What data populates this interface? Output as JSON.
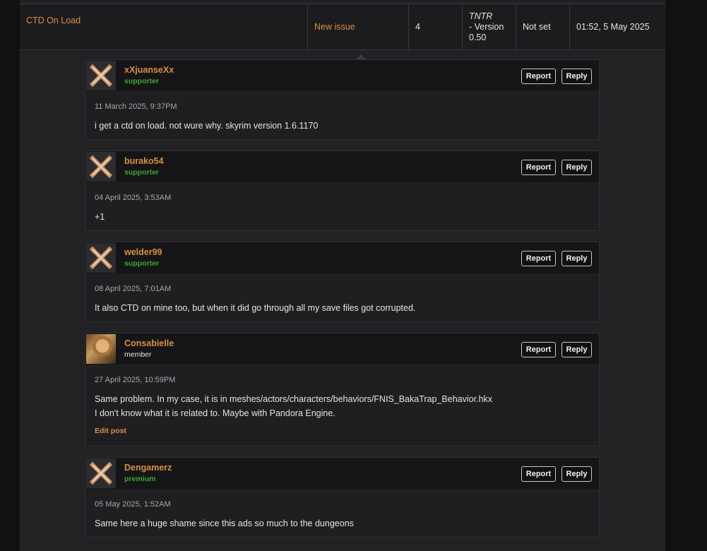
{
  "issue": {
    "title": "CTD On Load",
    "status": "New issue",
    "replies": "4",
    "version_mod": "TNTR",
    "version_label": "- Version 0.50",
    "priority": "Not set",
    "last_updated": "01:52, 5 May 2025"
  },
  "comments": [
    {
      "author": "xXjuanseXx",
      "role": "supporter",
      "date": "11 March 2025, 9:37PM",
      "text": "i get a ctd on load. not wure why. skyrim version 1.6.1170"
    },
    {
      "author": "burako54",
      "role": "supporter",
      "date": "04 April 2025, 3:53AM",
      "text": "+1"
    },
    {
      "author": "welder99",
      "role": "supporter",
      "date": "08 April 2025, 7:01AM",
      "text": "It also CTD on mine too, but when it did go through all my save files got corrupted."
    },
    {
      "author": "Consabielle",
      "role": "member",
      "date": "27 April 2025, 10:59PM",
      "text_line1": "Same problem. In my case, it is in meshes/actors/characters/behaviors/FNIS_BakaTrap_Behavior.hkx",
      "text_line2": "I don't know what it is related to. Maybe with Pandora Engine.",
      "edit_label": "Edit post"
    },
    {
      "author": "Dengamerz",
      "role": "premium",
      "date": "05 May 2025, 1:52AM",
      "text": "Same here a huge shame since this ads so much to the dungeons"
    }
  ],
  "buttons": {
    "report": "Report",
    "reply": "Reply"
  },
  "colors": {
    "accent": "#d98f40",
    "role_supporter": "#3aa831",
    "background": "#222225"
  }
}
